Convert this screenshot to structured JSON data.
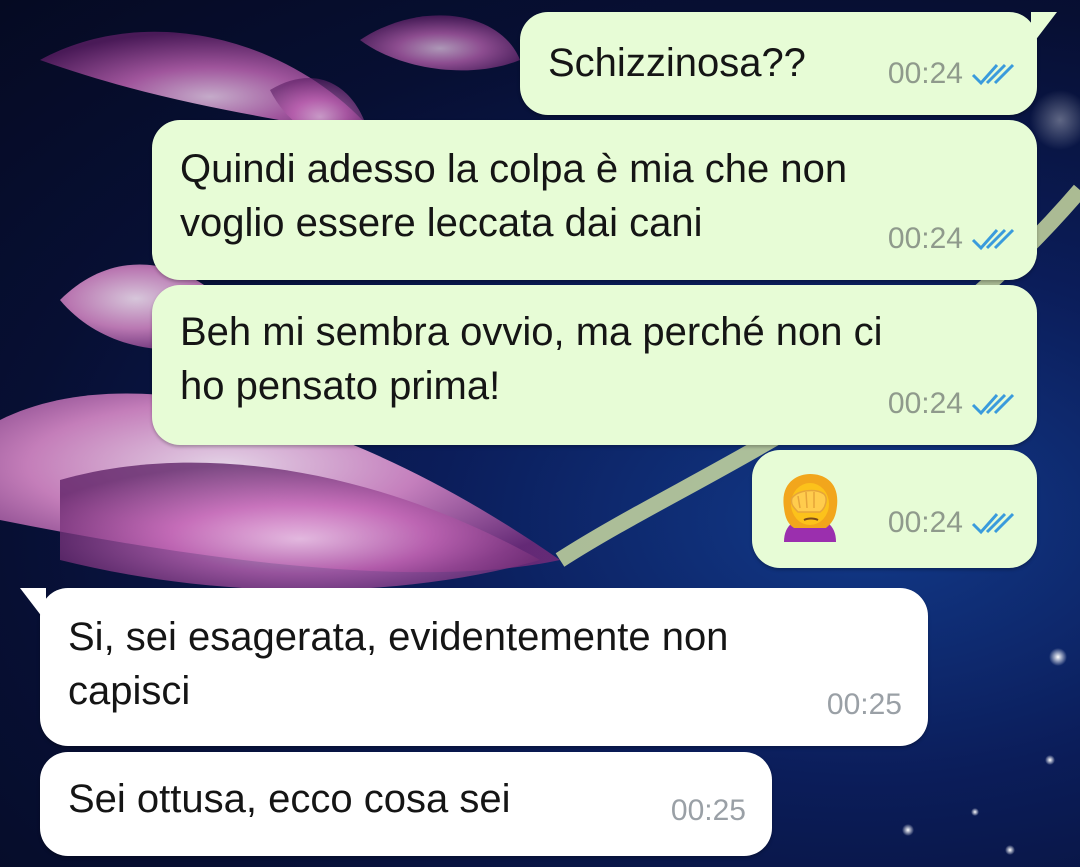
{
  "theme": {
    "outgoing_bubble": "#e7fcd6",
    "incoming_bubble": "#ffffff",
    "read_tick_color": "#3a9bdc"
  },
  "messages": [
    {
      "direction": "outgoing",
      "text": "Schizzinosa??",
      "time": "00:24",
      "status": "read-double-tick-icon"
    },
    {
      "direction": "outgoing",
      "text": "Quindi adesso la colpa è mia che non\nvoglio essere leccata dai cani",
      "time": "00:24",
      "status": "read-double-tick-icon"
    },
    {
      "direction": "outgoing",
      "text": "Beh mi sembra ovvio, ma perché non ci\nho pensato prima!",
      "time": "00:24",
      "status": "read-double-tick-icon"
    },
    {
      "direction": "outgoing",
      "emoji": "woman-facepalming-emoji",
      "time": "00:24",
      "status": "read-double-tick-icon"
    },
    {
      "direction": "incoming",
      "text": "Si, sei esagerata, evidentemente non\ncapisci",
      "time": "00:25"
    },
    {
      "direction": "incoming",
      "text": "Sei ottusa, ecco cosa sei",
      "time": "00:25"
    }
  ]
}
